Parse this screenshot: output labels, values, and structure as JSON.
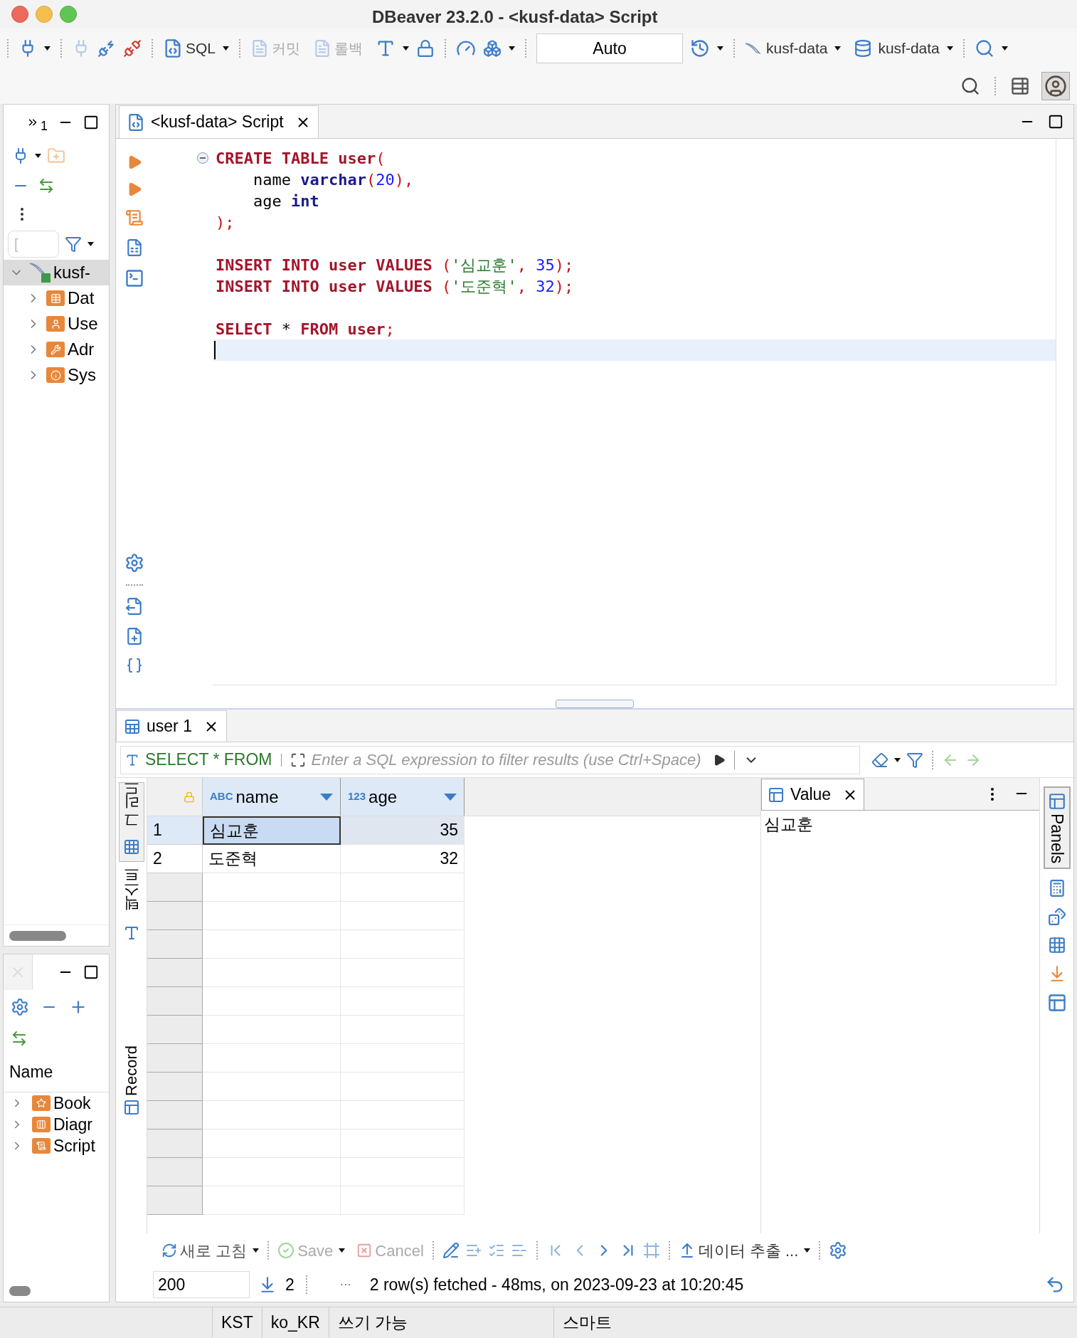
{
  "window": {
    "title": "DBeaver 23.2.0 - <kusf-data> Script"
  },
  "toolbar": {
    "sql": "SQL",
    "commit": {
      "label": "커밋",
      "disabled": true
    },
    "rollback": {
      "label": "롤백",
      "disabled": true
    },
    "transaction_mode": "Auto",
    "datasource": "kusf-data",
    "schema": "kusf-data"
  },
  "navigator": {
    "overflow_count": "1",
    "filter_placeholder": "[",
    "tree": [
      {
        "label": "kusf-",
        "expanded": true,
        "selected": true,
        "children": [
          {
            "label": "Dat",
            "kind": "databases",
            "expanded": false,
            "selected": false
          },
          {
            "label": "Use",
            "kind": "users",
            "expanded": false,
            "selected": false
          },
          {
            "label": "Adr",
            "kind": "administer",
            "expanded": false,
            "selected": false
          },
          {
            "label": "Sys",
            "kind": "system",
            "expanded": false,
            "selected": false
          }
        ]
      }
    ]
  },
  "projects": {
    "column": "Name",
    "items": [
      {
        "label": "Book",
        "kind": "bookmarks",
        "expanded": false
      },
      {
        "label": "Diagr",
        "kind": "diagrams",
        "expanded": false
      },
      {
        "label": "Script",
        "kind": "scripts",
        "expanded": false
      }
    ]
  },
  "editor": {
    "tab": "<kusf-data> Script",
    "lines": [
      {
        "kind": "code",
        "fold": true,
        "tokens": [
          {
            "kind": "keyword",
            "text": "CREATE TABLE user"
          },
          {
            "kind": "punct",
            "text": "("
          }
        ]
      },
      {
        "kind": "code",
        "fold": false,
        "tokens": [
          {
            "kind": "plain",
            "text": "    name "
          },
          {
            "kind": "type",
            "text": "varchar"
          },
          {
            "kind": "punct",
            "text": "("
          },
          {
            "kind": "number",
            "text": "20"
          },
          {
            "kind": "punct",
            "text": "),"
          }
        ]
      },
      {
        "kind": "code",
        "fold": false,
        "tokens": [
          {
            "kind": "plain",
            "text": "    age "
          },
          {
            "kind": "type",
            "text": "int"
          }
        ]
      },
      {
        "kind": "code",
        "fold": false,
        "tokens": [
          {
            "kind": "punct",
            "text": ");"
          }
        ]
      },
      {
        "kind": "blank"
      },
      {
        "kind": "code",
        "fold": false,
        "tokens": [
          {
            "kind": "keyword",
            "text": "INSERT INTO user VALUES"
          },
          {
            "kind": "punct",
            "text": " ("
          },
          {
            "kind": "string",
            "text": "'심교훈'"
          },
          {
            "kind": "punct",
            "text": ", "
          },
          {
            "kind": "number",
            "text": "35"
          },
          {
            "kind": "punct",
            "text": ");"
          }
        ]
      },
      {
        "kind": "code",
        "fold": false,
        "tokens": [
          {
            "kind": "keyword",
            "text": "INSERT INTO user VALUES"
          },
          {
            "kind": "punct",
            "text": " ("
          },
          {
            "kind": "string",
            "text": "'도준혁'"
          },
          {
            "kind": "punct",
            "text": ", "
          },
          {
            "kind": "number",
            "text": "32"
          },
          {
            "kind": "punct",
            "text": ");"
          }
        ]
      },
      {
        "kind": "blank"
      },
      {
        "kind": "code",
        "fold": false,
        "tokens": [
          {
            "kind": "keyword",
            "text": "SELECT"
          },
          {
            "kind": "plain",
            "text": " * "
          },
          {
            "kind": "keyword",
            "text": "FROM user"
          },
          {
            "kind": "punct",
            "text": ";"
          }
        ]
      },
      {
        "kind": "cursor"
      }
    ]
  },
  "results": {
    "tab": "user 1",
    "query": "SELECT * FROM",
    "filter_placeholder": "Enter a SQL expression to filter results (use Ctrl+Space)",
    "side_tabs": [
      {
        "label": "그리드",
        "kind": "grid",
        "selected": true
      },
      {
        "label": "텍스트",
        "kind": "text",
        "selected": false
      },
      {
        "label": "Record",
        "kind": "record",
        "selected": false
      }
    ],
    "columns": [
      {
        "type": "ABC",
        "name": "name"
      },
      {
        "type": "123",
        "name": "age"
      }
    ],
    "rows": [
      {
        "number": "1",
        "cells": [
          "심교훈",
          "35"
        ],
        "selected": true
      },
      {
        "number": "2",
        "cells": [
          "도준혁",
          "32"
        ],
        "selected": false
      }
    ],
    "value_panel": {
      "title": "Value",
      "content": "심교훈"
    },
    "panels_label": "Panels",
    "bottom_toolbar": {
      "refresh": "새로 고침",
      "save": {
        "label": "Save",
        "disabled": true
      },
      "cancel": {
        "label": "Cancel",
        "disabled": true
      },
      "export": "데이터 추출 ..."
    },
    "fetch_size": "200",
    "row_count": "2",
    "more": "···",
    "status": "2 row(s) fetched - 48ms, on 2023-09-23 at 10:20:45"
  },
  "status_bar": [
    "KST",
    "ko_KR",
    "쓰기 가능",
    "스마트"
  ]
}
